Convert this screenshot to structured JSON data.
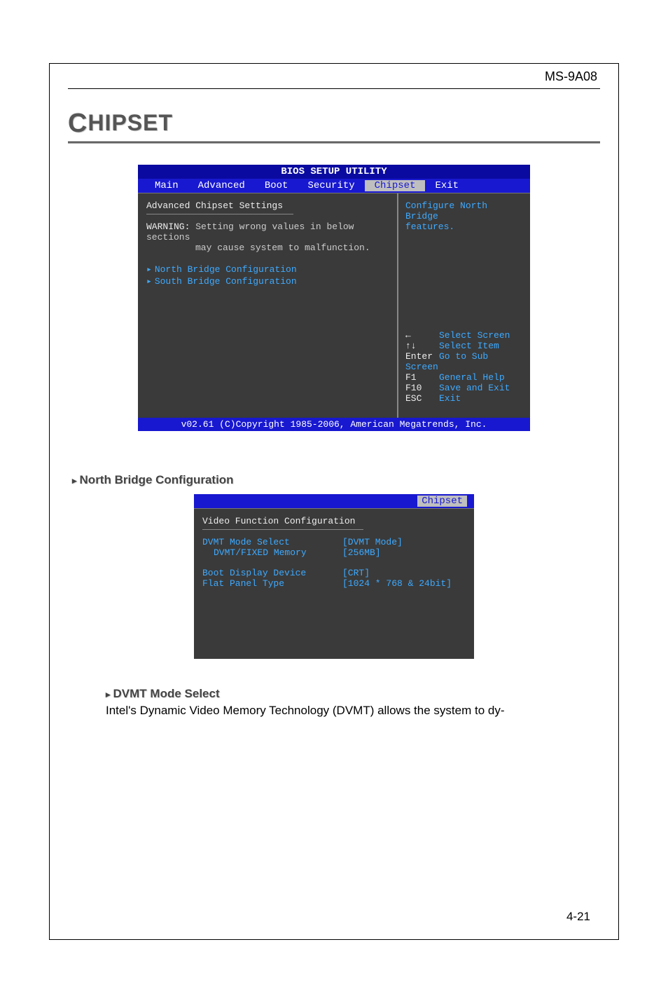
{
  "header": {
    "model": "MS-9A08"
  },
  "section": {
    "title_big": "C",
    "title_rest": "HIPSET"
  },
  "bios": {
    "title": "BIOS SETUP UTILITY",
    "tabs": [
      "Main",
      "Advanced",
      "Boot",
      "Security",
      "Chipset",
      "Exit"
    ],
    "active_tab_index": 4,
    "left": {
      "heading": "Advanced Chipset Settings",
      "warn_label": "WARNING:",
      "warn1": "Setting wrong values in below sections",
      "warn2": "may cause system to malfunction.",
      "item1": "North Bridge Configuration",
      "item2": "South Bridge Configuration"
    },
    "right": {
      "desc1": "Configure North Bridge",
      "desc2": "features.",
      "keys": [
        {
          "k": "←",
          "lbl": "Select Screen"
        },
        {
          "k": "↑↓",
          "lbl": "Select Item"
        },
        {
          "k": "Enter",
          "lbl": "Go to Sub Screen"
        },
        {
          "k": "F1",
          "lbl": "General Help"
        },
        {
          "k": "F10",
          "lbl": "Save and Exit"
        },
        {
          "k": "ESC",
          "lbl": "Exit"
        }
      ]
    },
    "footer": "v02.61 (C)Copyright 1985-2006, American Megatrends, Inc."
  },
  "sub1": {
    "tri": "▸",
    "label": "North Bridge Configuration"
  },
  "bios2": {
    "tab_label": "Chipset",
    "heading": "Video Function Configuration",
    "rows": [
      {
        "l": "DVMT Mode Select",
        "v": "[DVMT Mode]",
        "indent": false
      },
      {
        "l": "DVMT/FIXED Memory",
        "v": "[256MB]",
        "indent": true
      },
      {
        "l_spacer": true
      },
      {
        "l": "Boot Display Device",
        "v": "[CRT]",
        "indent": false
      },
      {
        "l": "Flat Panel Type",
        "v": "[1024 * 768 & 24bit]",
        "indent": false
      }
    ]
  },
  "sub2": {
    "tri": "▸",
    "label": "DVMT Mode Select"
  },
  "para": "Intel's Dynamic Video Memory Technology (DVMT) allows the system to dy-",
  "page_num": "4-21"
}
